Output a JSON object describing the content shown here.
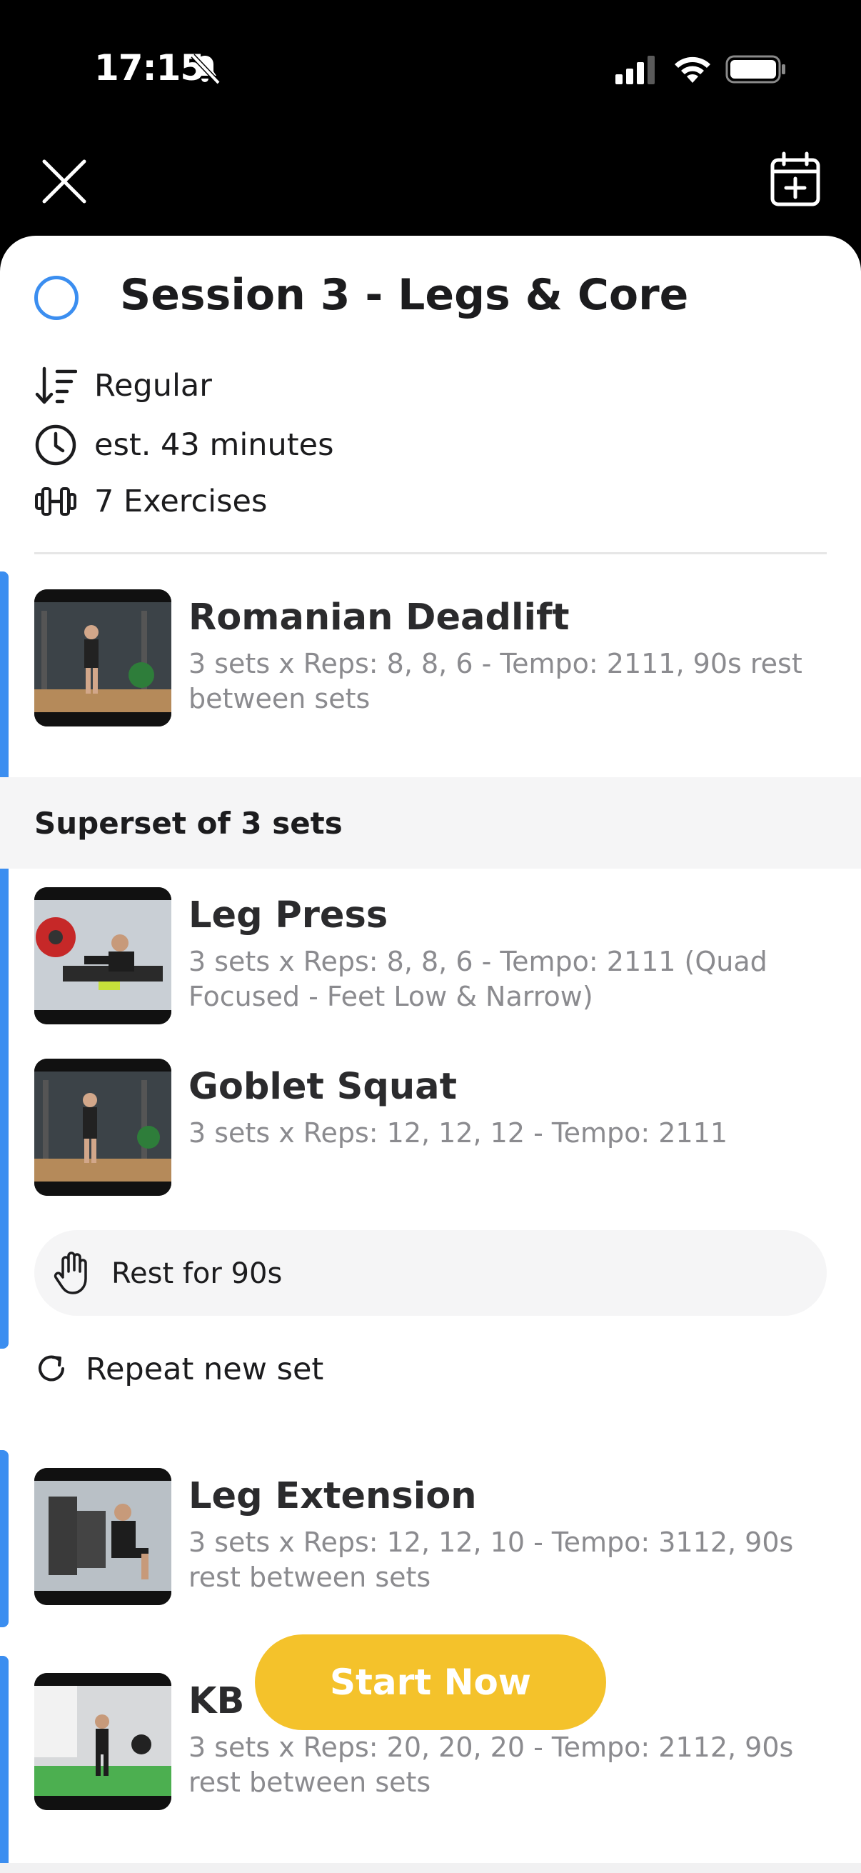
{
  "status_bar": {
    "time": "17:15"
  },
  "session": {
    "title": "Session 3 - Legs & Core",
    "meta": {
      "order": "Regular",
      "duration": "est. 43 minutes",
      "exercise_count": "7 Exercises"
    }
  },
  "exercises": [
    {
      "name": "Romanian Deadlift",
      "desc": "3 sets x Reps: 8, 8, 6 - Tempo: 2111, 90s rest between sets"
    },
    {
      "name": "Leg Press",
      "desc": "3 sets x Reps: 8, 8, 6 - Tempo: 2111 (Quad Focused - Feet Low & Narrow)"
    },
    {
      "name": "Goblet Squat",
      "desc": "3 sets x Reps: 12, 12, 12 - Tempo: 2111"
    },
    {
      "name": "Leg Extension",
      "desc": "3 sets x Reps: 12, 12, 10 - Tempo: 3112, 90s rest between sets"
    },
    {
      "name": "KB V",
      "desc": "3 sets x Reps: 20, 20, 20 - Tempo: 2112, 90s rest between sets"
    }
  ],
  "superset": {
    "label": "Superset of 3 sets",
    "rest_label": "Rest for 90s",
    "repeat_label": "Repeat new set"
  },
  "cta": {
    "start_label": "Start Now"
  },
  "colors": {
    "accent": "#3b8ef0",
    "cta": "#f4c22b"
  }
}
